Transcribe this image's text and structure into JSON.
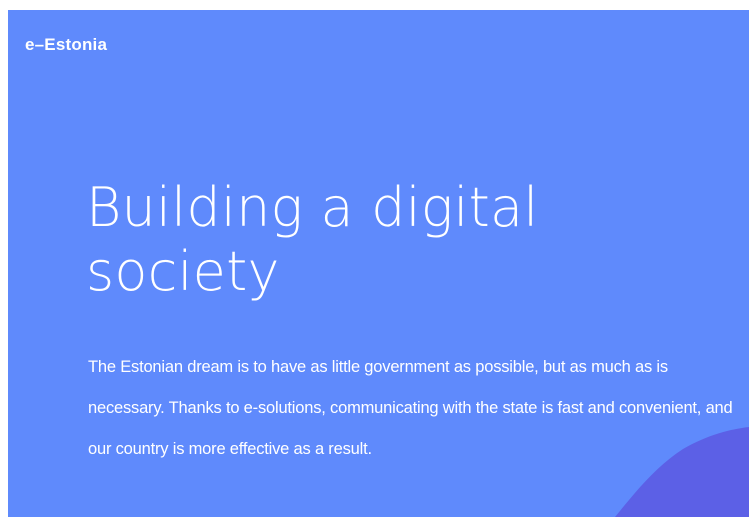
{
  "brand": {
    "logo_text": "e–Estonia"
  },
  "hero": {
    "headline_line1": "Building a digital",
    "headline_line2": "society",
    "lead_text": "The Estonian dream is to have as little government as possible, but as much as is necessary. Thanks to e-solutions, communicating with the state is fast and convenient, and our country is more effective as a result."
  },
  "colors": {
    "hero_background": "#5f8afc",
    "text": "#ffffff",
    "decor_shape": "#5c60e6"
  }
}
